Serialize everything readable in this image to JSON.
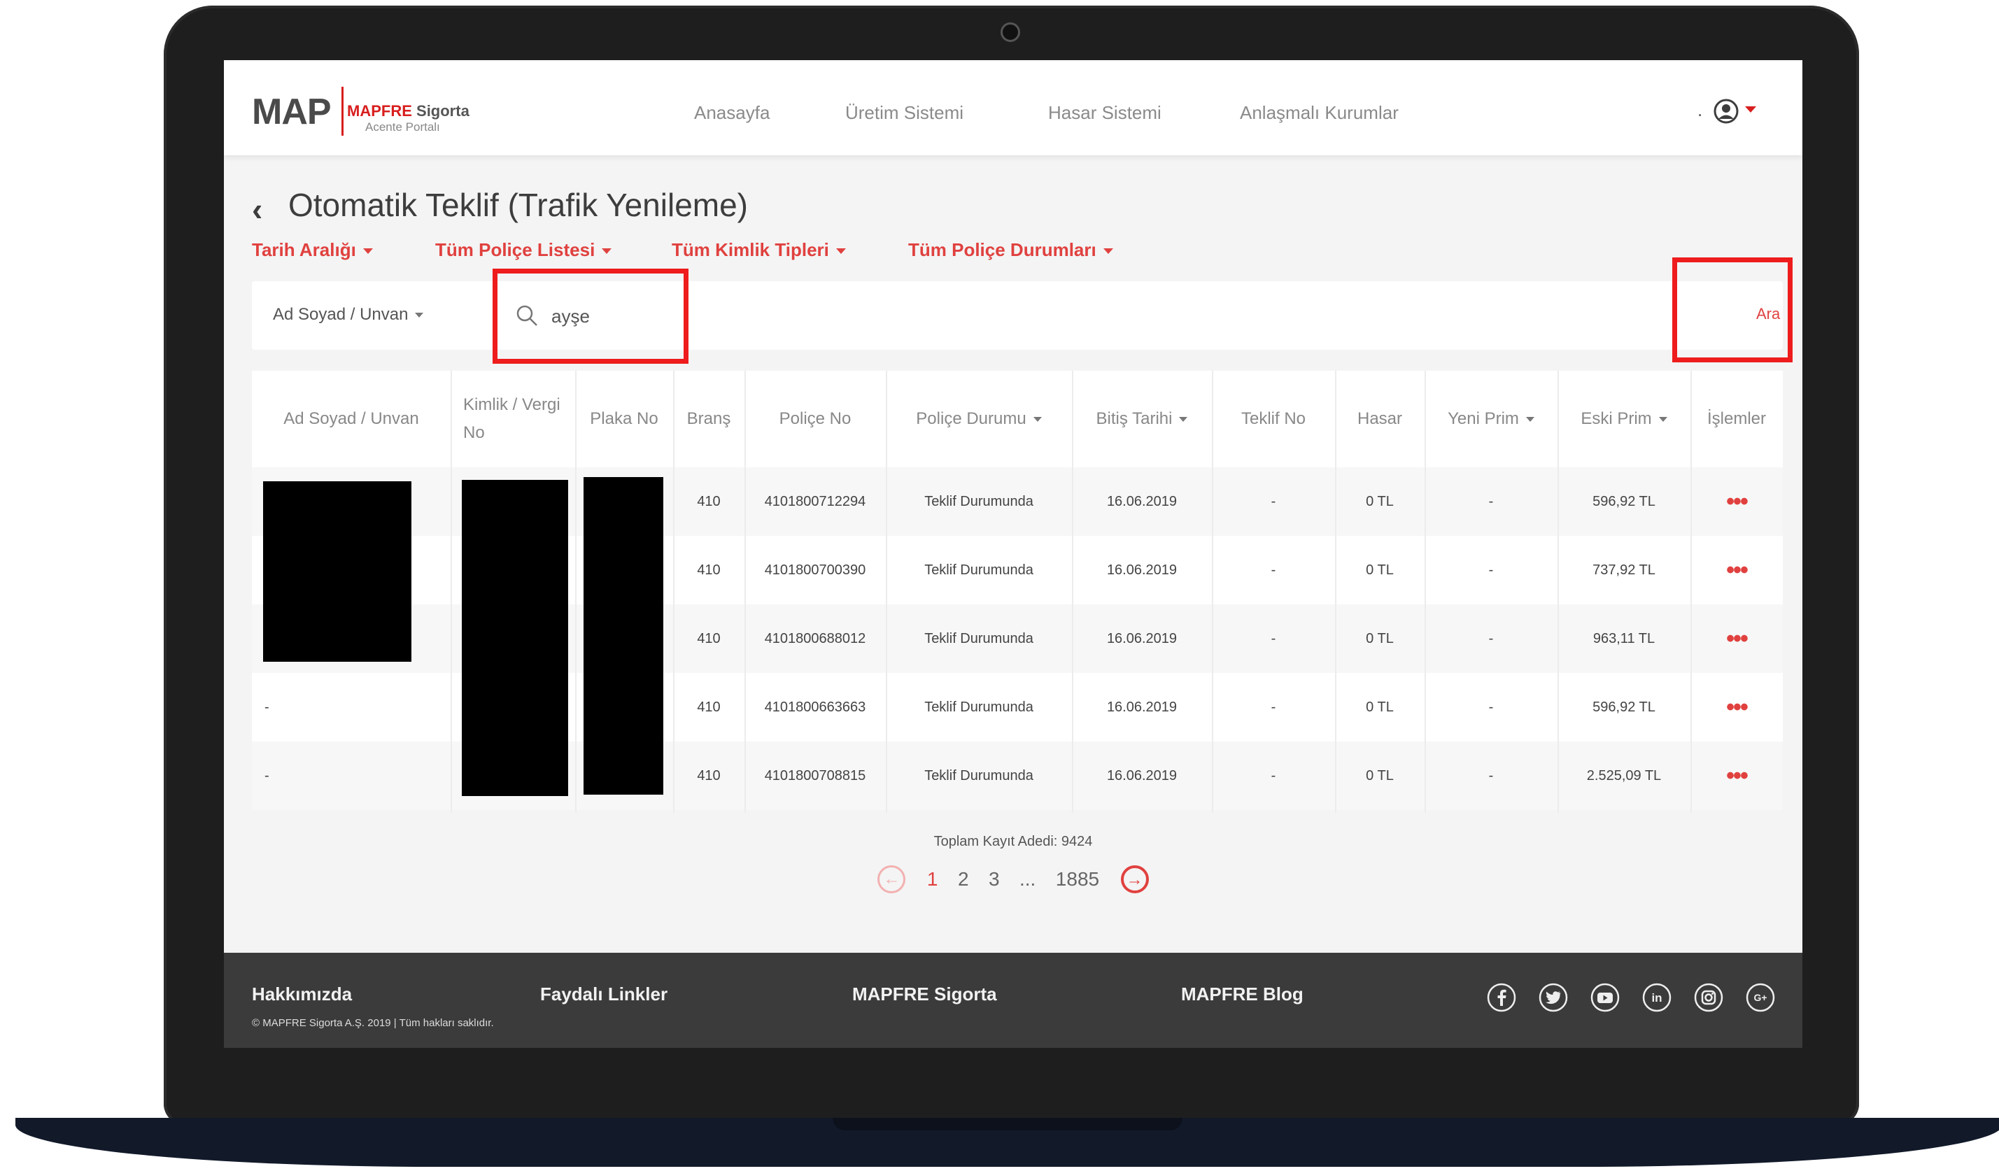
{
  "header": {
    "logo_text": "MAP",
    "brand": "MAPFRE",
    "brand_suffix": "Sigorta",
    "portal": "Acente Portalı",
    "nav": [
      "Anasayfa",
      "Üretim Sistemi",
      "Hasar Sistemi",
      "Anlaşmalı Kurumlar"
    ],
    "user_prefix": "."
  },
  "page": {
    "title": "Otomatik Teklif (Trafik Yenileme)",
    "filters": [
      "Tarih Aralığı",
      "Tüm Poliçe Listesi",
      "Tüm Kimlik Tipleri",
      "Tüm Poliçe Durumları"
    ]
  },
  "search": {
    "type_label": "Ad Soyad / Unvan",
    "value": "ayşe",
    "button": "Ara"
  },
  "table": {
    "headers": [
      "Ad Soyad / Unvan",
      "Kimlik / Vergi No",
      "Plaka No",
      "Branş",
      "Poliçe No",
      "Poliçe Durumu",
      "Bitiş Tarihi",
      "Teklif No",
      "Hasar",
      "Yeni Prim",
      "Eski Prim",
      "İşlemler"
    ],
    "rows": [
      {
        "name": "",
        "kimlik": "",
        "plaka": "",
        "brans": "410",
        "police_no": "4101800712294",
        "durum": "Teklif Durumunda",
        "bitis": "16.06.2019",
        "teklif_no": "-",
        "hasar": "0 TL",
        "yeni_prim": "-",
        "eski_prim": "596,92 TL",
        "islem": "•••"
      },
      {
        "name": "",
        "kimlik": "",
        "plaka": "",
        "brans": "410",
        "police_no": "4101800700390",
        "durum": "Teklif Durumunda",
        "bitis": "16.06.2019",
        "teklif_no": "-",
        "hasar": "0 TL",
        "yeni_prim": "-",
        "eski_prim": "737,92 TL",
        "islem": "•••"
      },
      {
        "name": "",
        "kimlik": "",
        "plaka": "",
        "brans": "410",
        "police_no": "4101800688012",
        "durum": "Teklif Durumunda",
        "bitis": "16.06.2019",
        "teklif_no": "-",
        "hasar": "0 TL",
        "yeni_prim": "-",
        "eski_prim": "963,11 TL",
        "islem": "•••"
      },
      {
        "name": "-",
        "kimlik": "",
        "plaka": "",
        "brans": "410",
        "police_no": "4101800663663",
        "durum": "Teklif Durumunda",
        "bitis": "16.06.2019",
        "teklif_no": "-",
        "hasar": "0 TL",
        "yeni_prim": "-",
        "eski_prim": "596,92 TL",
        "islem": "•••"
      },
      {
        "name": "-",
        "kimlik": "",
        "plaka": "",
        "brans": "410",
        "police_no": "4101800708815",
        "durum": "Teklif Durumunda",
        "bitis": "16.06.2019",
        "teklif_no": "-",
        "hasar": "0 TL",
        "yeni_prim": "-",
        "eski_prim": "2.525,09 TL",
        "islem": "•••"
      }
    ]
  },
  "pagination": {
    "total_label": "Toplam Kayıt Adedi: 9424",
    "pages": [
      "1",
      "2",
      "3",
      "...",
      "1885"
    ],
    "current": "1"
  },
  "footer": {
    "links": [
      "Hakkımızda",
      "Faydalı Linkler",
      "MAPFRE Sigorta",
      "MAPFRE Blog"
    ],
    "copyright": "© MAPFRE Sigorta A.Ş. 2019 | Tüm hakları saklıdır.",
    "social_icons": [
      "facebook-icon",
      "twitter-icon",
      "youtube-icon",
      "linkedin-icon",
      "instagram-icon",
      "google-plus-icon"
    ]
  },
  "colors": {
    "accent": "#e0413f",
    "highlight": "#ee1c1c",
    "footer_bg": "#3b3b3b",
    "frame": "#1e1e1f"
  }
}
